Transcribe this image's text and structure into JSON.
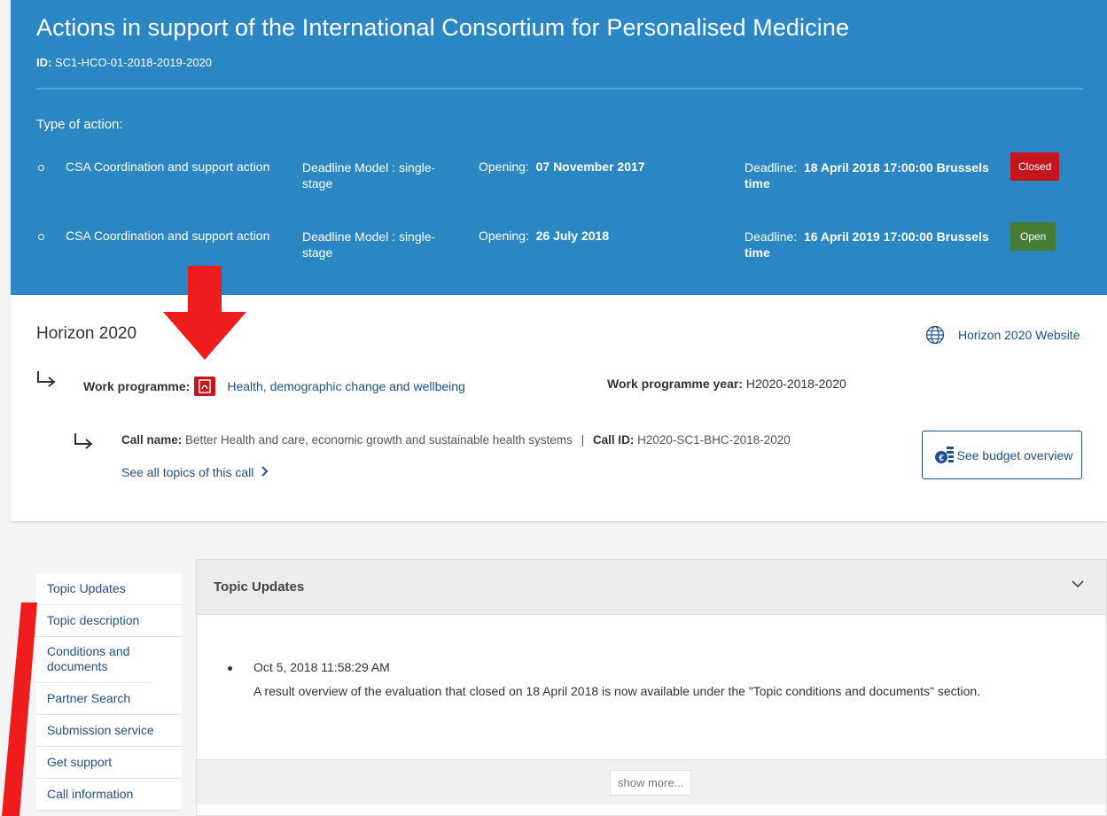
{
  "header": {
    "title": "Actions in support of the International Consortium for Personalised Medicine",
    "id_label": "ID:",
    "id_value": "SC1-HCO-01-2018-2019-2020",
    "type_label": "Type of action:",
    "actions": [
      {
        "type": "CSA Coordination and support action",
        "model": "Deadline Model : single-stage",
        "opening_label": "Opening:",
        "opening_date": "07 November 2017",
        "deadline_label": "Deadline:",
        "deadline_value": "18 April 2018 17:00:00 Brussels time",
        "status": "Closed",
        "status_color": "#c4161c"
      },
      {
        "type": "CSA Coordination and support action",
        "model": "Deadline Model : single-stage",
        "opening_label": "Opening:",
        "opening_date": "26 July 2018",
        "deadline_label": "Deadline:",
        "deadline_value": "16 April 2019 17:00:00 Brussels time",
        "status": "Open",
        "status_color": "#467c33"
      }
    ]
  },
  "programme": {
    "name": "Horizon 2020",
    "website_label": "Horizon 2020 Website",
    "wp_label": "Work programme:",
    "wp_link": "Health, demographic change and wellbeing",
    "wp_year_label": "Work programme year:",
    "wp_year": "H2020-2018-2020",
    "call_name_label": "Call name:",
    "call_name": "Better Health and care, economic growth and sustainable health systems",
    "call_sep": "|",
    "call_id_label": "Call ID:",
    "call_id": "H2020-SC1-BHC-2018-2020",
    "all_topics_label": "See all topics of this call",
    "budget_label": "See budget overview"
  },
  "sidenav": {
    "items": [
      "Topic Updates",
      "Topic description",
      "Conditions and documents",
      "Partner Search",
      "Submission service",
      "Get support",
      "Call information"
    ]
  },
  "content": {
    "section_title": "Topic Updates",
    "update_date": "Oct 5, 2018 11:58:29 AM",
    "update_text": "A result overview of the evaluation that closed on 18 April 2018 is now available under the \"Topic conditions and documents\" section.",
    "show_more": "show more..."
  },
  "colors": {
    "header_bg": "#2b87c4",
    "link": "#1f4f8f",
    "annotation_arrow": "#ee1c1c"
  }
}
